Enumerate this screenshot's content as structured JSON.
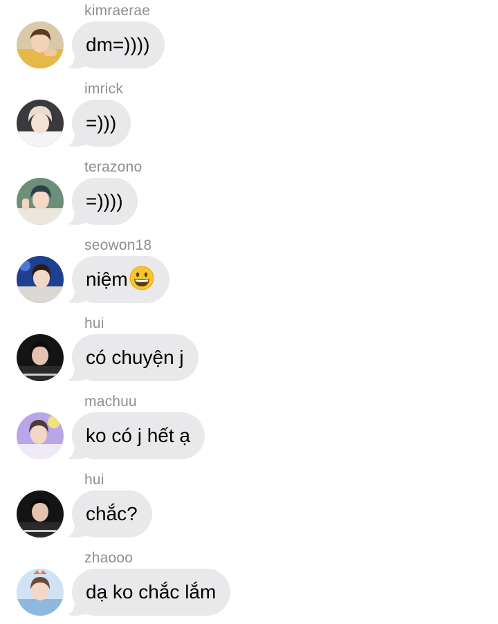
{
  "messages": [
    {
      "sender": "kimraerae",
      "text": "dm=))))",
      "avatar": "avatar-kimraerae"
    },
    {
      "sender": "imrick",
      "text": "=)))",
      "avatar": "avatar-imrick"
    },
    {
      "sender": "terazono",
      "text": "=))))",
      "avatar": "avatar-terazono"
    },
    {
      "sender": "seowon18",
      "text": "niệm",
      "emoji": "grinning-face-emoji",
      "avatar": "avatar-seowon18"
    },
    {
      "sender": "hui",
      "text": "có chuyện j",
      "avatar": "avatar-hui"
    },
    {
      "sender": "machuu",
      "text": "ko có j hết ạ",
      "avatar": "avatar-machuu"
    },
    {
      "sender": "hui",
      "text": "chắc?",
      "avatar": "avatar-hui"
    },
    {
      "sender": "zhaooo",
      "text": "dạ ko chắc lắm",
      "avatar": "avatar-zhaooo"
    }
  ],
  "colors": {
    "bubble_bg": "#e9e9eb",
    "sender_text": "#8e8e93",
    "message_text": "#000000",
    "background": "#ffffff"
  }
}
